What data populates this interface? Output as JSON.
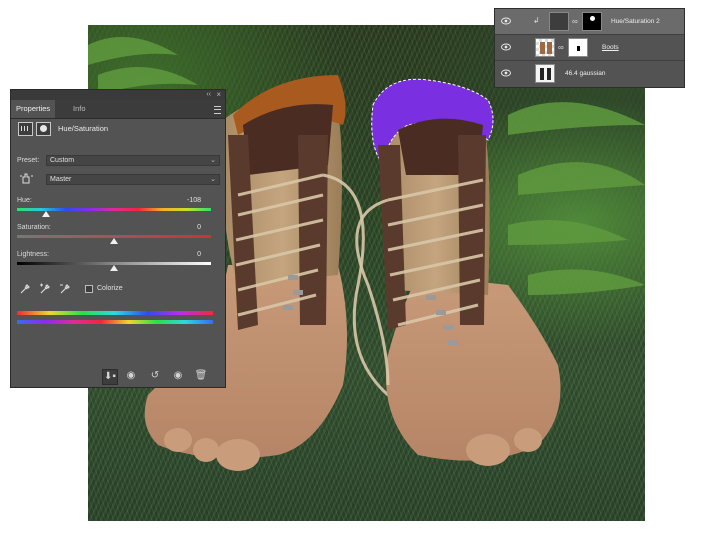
{
  "properties_panel": {
    "tabs": [
      {
        "label": "Properties"
      },
      {
        "label": "Info"
      }
    ],
    "adjustment_title": "Hue/Saturation",
    "preset": {
      "label": "Preset:",
      "value": "Custom"
    },
    "channel": {
      "value": "Master"
    },
    "hue": {
      "label": "Hue:",
      "value": "-108",
      "slider_fraction": 0.15
    },
    "saturation": {
      "label": "Saturation:",
      "value": "0",
      "slider_fraction": 0.5
    },
    "lightness": {
      "label": "Lightness:",
      "value": "0",
      "slider_fraction": 0.5
    },
    "colorize": {
      "label": "Colorize",
      "checked": false
    }
  },
  "layers_panel": {
    "layers": [
      {
        "name": "Hue/Saturation 2",
        "selected": true,
        "type": "adjustment"
      },
      {
        "name": "Boots",
        "selected": false,
        "type": "masked"
      },
      {
        "name": "46.4 gaussian",
        "selected": false,
        "type": "raster"
      }
    ]
  },
  "colors": {
    "panel_bg": "#535353",
    "panel_dark": "#3c3c3c",
    "selection": "#6b6b6b",
    "hue_shift_result": "#7a2fe0"
  }
}
